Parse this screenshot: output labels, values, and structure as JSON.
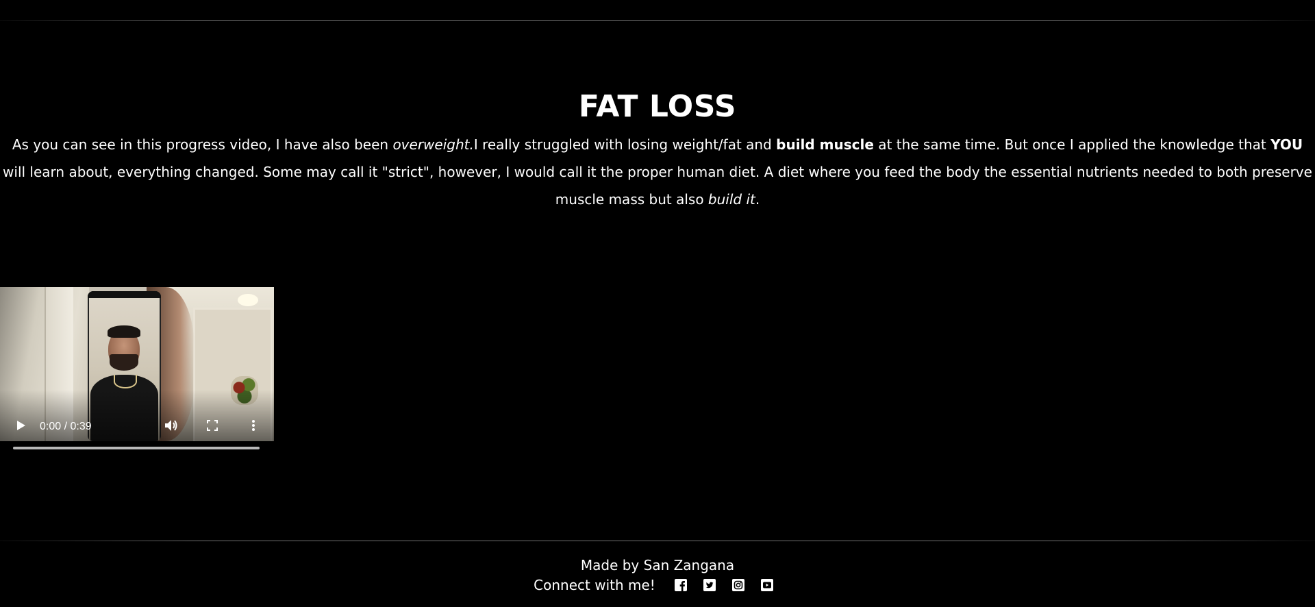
{
  "section": {
    "title": "FAT LOSS",
    "paragraph": {
      "p1": "As you can see in this progress video, I have also been ",
      "p2_em": "overweight.",
      "p3": "I really struggled with losing weight/fat and ",
      "p4_strong": "build muscle",
      "p5": " at the same time. But once I applied the knowledge that ",
      "p6_strong": "YOU",
      "p7": " will learn about, everything changed. Some may call it \"strict\", however, I would call it the proper human diet. A diet where you feed the body the essential nutrients needed to both preserve muscle mass but also ",
      "p8_em": "build it",
      "p9": "."
    }
  },
  "video": {
    "time_display": "0:00 / 0:39",
    "progress": 0,
    "icons": [
      "play-icon",
      "volume-icon",
      "fullscreen-icon",
      "more-options-icon"
    ]
  },
  "footer": {
    "made_by": "Made by San Zangana",
    "connect_label": "Connect with me!",
    "social_icons": [
      "facebook-icon",
      "twitter-icon",
      "instagram-icon",
      "youtube-icon"
    ]
  },
  "colors": {
    "background": "#000000",
    "text": "#ffffff"
  }
}
